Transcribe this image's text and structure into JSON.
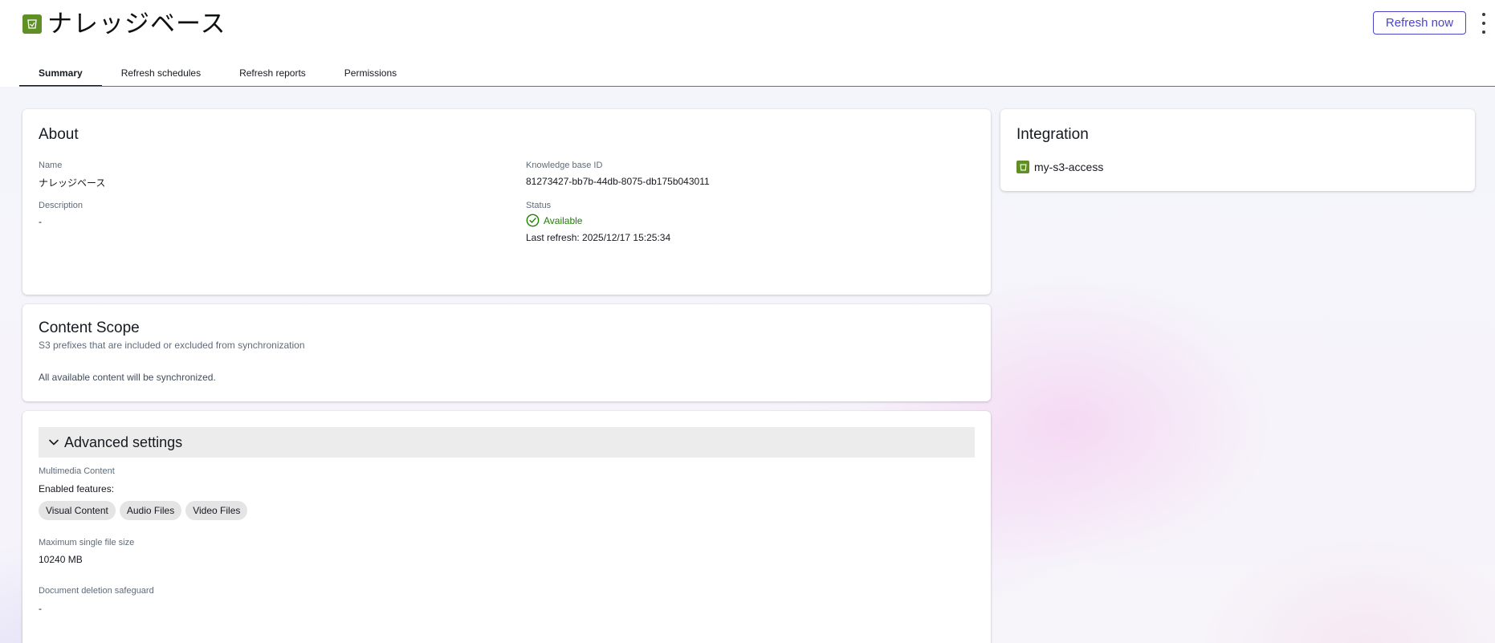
{
  "header": {
    "title": "ナレッジベース",
    "refresh_label": "Refresh now",
    "icon": "bucket-icon"
  },
  "tabs": [
    {
      "label": "Summary",
      "active": true
    },
    {
      "label": "Refresh schedules",
      "active": false
    },
    {
      "label": "Refresh reports",
      "active": false
    },
    {
      "label": "Permissions",
      "active": false
    }
  ],
  "about": {
    "title": "About",
    "name_label": "Name",
    "name_value": "ナレッジベース",
    "description_label": "Description",
    "description_value": "-",
    "kb_id_label": "Knowledge base ID",
    "kb_id_value": "81273427-bb7b-44db-8075-db175b043011",
    "status_label": "Status",
    "status_value": "Available",
    "last_refresh": "Last refresh: 2025/12/17 15:25:34"
  },
  "scope": {
    "title": "Content Scope",
    "subtitle": "S3 prefixes that are included or excluded from synchronization",
    "body": "All available content will be synchronized."
  },
  "advanced": {
    "title": "Advanced settings",
    "multimedia_label": "Multimedia Content",
    "enabled_label": "Enabled features:",
    "features": [
      "Visual Content",
      "Audio Files",
      "Video Files"
    ],
    "max_size_label": "Maximum single file size",
    "max_size_value": "10240 MB",
    "deletion_label": "Document deletion safeguard",
    "deletion_value": "-"
  },
  "integration": {
    "title": "Integration",
    "item_label": "my-s3-access"
  },
  "colors": {
    "accent": "#4b44c9",
    "status_green": "#1d8102",
    "icon_green": "#5f8f25"
  }
}
